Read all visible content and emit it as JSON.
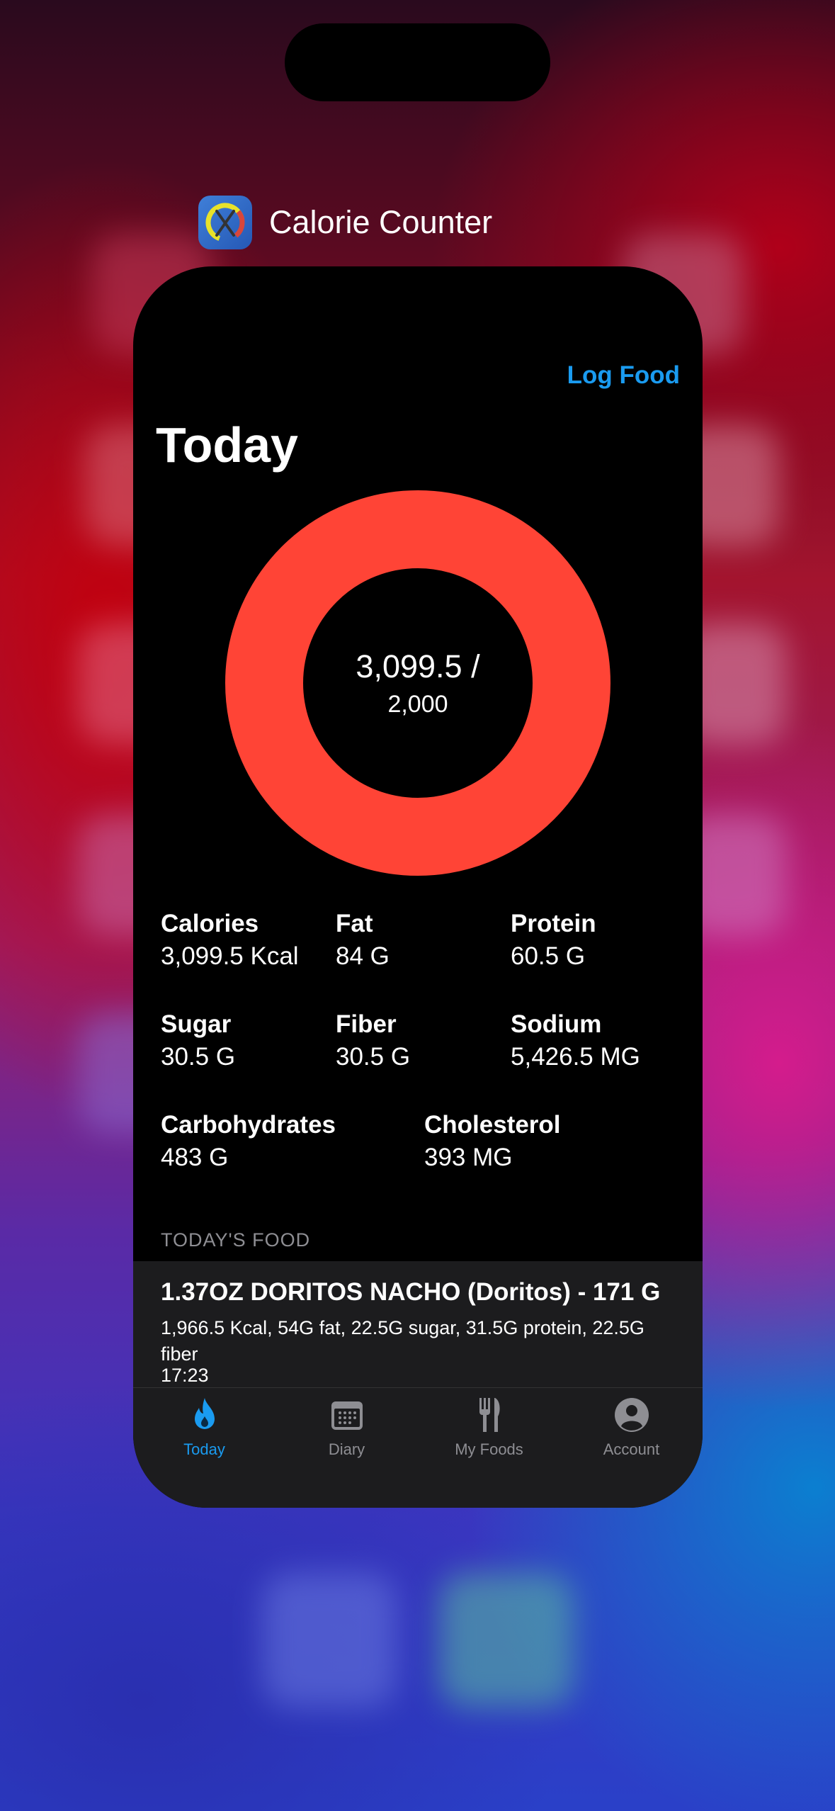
{
  "app": {
    "name": "Calorie Counter"
  },
  "header": {
    "action_label": "Log Food",
    "title": "Today"
  },
  "ring": {
    "consumed": "3,099.5 /",
    "goal": "2,000",
    "color": "#ff4436",
    "progress_fraction": 1.0
  },
  "stats": [
    {
      "label": "Calories",
      "value": "3,099.5 Kcal"
    },
    {
      "label": "Fat",
      "value": "84 G"
    },
    {
      "label": "Protein",
      "value": "60.5 G"
    },
    {
      "label": "Sugar",
      "value": "30.5 G"
    },
    {
      "label": "Fiber",
      "value": "30.5 G"
    },
    {
      "label": "Sodium",
      "value": "5,426.5 MG"
    },
    {
      "label": "Carbohydrates",
      "value": "483 G"
    },
    {
      "label": "Cholesterol",
      "value": "393 MG"
    }
  ],
  "food_section": {
    "header": "TODAY'S FOOD",
    "items": [
      {
        "title": "1.37OZ DORITOS NACHO (Doritos) - 171 G",
        "detail": "1,966.5 Kcal, 54G fat, 22.5G sugar, 31.5G protein, 22.5G fiber",
        "time": "17:23"
      }
    ]
  },
  "tabs": [
    {
      "label": "Today",
      "icon": "flame-icon",
      "active": true
    },
    {
      "label": "Diary",
      "icon": "calendar-icon",
      "active": false
    },
    {
      "label": "My Foods",
      "icon": "fork-knife-icon",
      "active": false
    },
    {
      "label": "Account",
      "icon": "person-icon",
      "active": false
    }
  ],
  "colors": {
    "accent": "#1a9bf0",
    "ring": "#ff4436"
  }
}
